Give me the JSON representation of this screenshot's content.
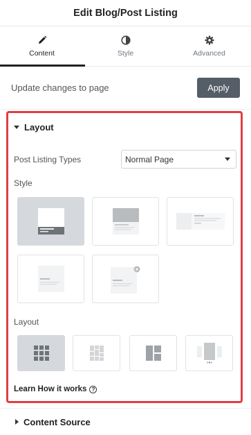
{
  "header": {
    "title": "Edit Blog/Post Listing"
  },
  "tabs": [
    {
      "label": "Content",
      "icon": "pencil-icon",
      "active": true
    },
    {
      "label": "Style",
      "icon": "contrast-icon",
      "active": false
    },
    {
      "label": "Advanced",
      "icon": "gear-icon",
      "active": false
    }
  ],
  "update": {
    "text": "Update changes to page",
    "button": "Apply"
  },
  "layout_section": {
    "title": "Layout",
    "post_listing_types_label": "Post Listing Types",
    "post_listing_types_value": "Normal Page",
    "style_label": "Style",
    "style_options_selected": 1,
    "layout_label": "Layout",
    "layout_options_selected": 1,
    "learn_link": "Learn How it works",
    "learn_icon": "question-circle-icon"
  },
  "content_source": {
    "title": "Content Source"
  },
  "colors": {
    "accent_border": "#e03e44",
    "apply_button": "#555d66",
    "selected_option": "#d5d8dc"
  }
}
